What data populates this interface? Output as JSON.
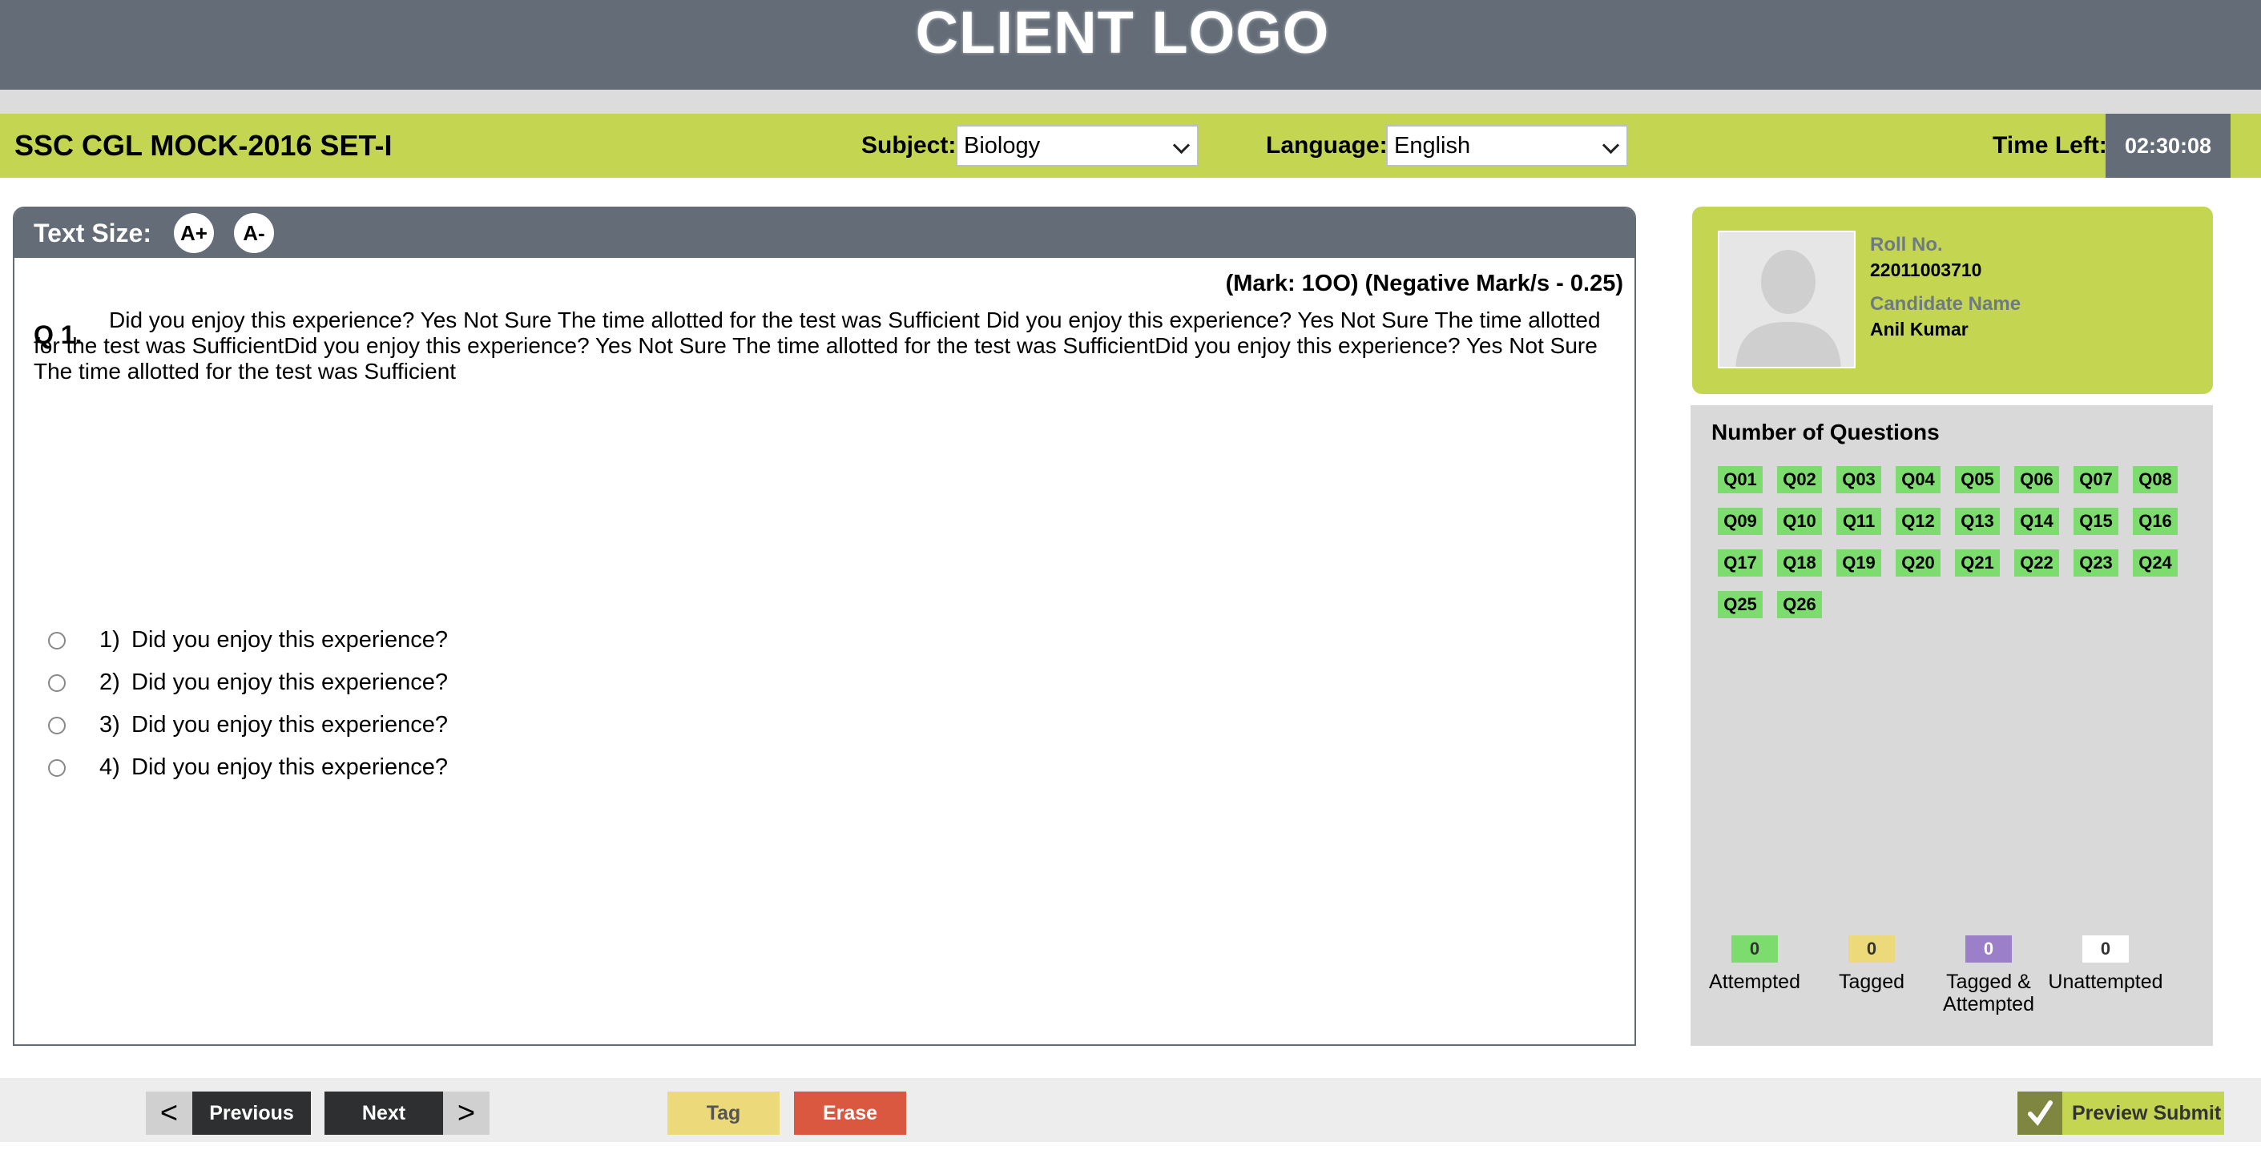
{
  "header": {
    "logo_text": "CLIENT LOGO"
  },
  "exam": {
    "title": "SSC CGL MOCK-2016 SET-I",
    "subject_label": "Subject:",
    "subject_value": "Biology",
    "language_label": "Language:",
    "language_value": "English",
    "time_left_label": "Time Left:",
    "time_left_value": "02:30:08"
  },
  "question_panel": {
    "text_size_label": "Text Size:",
    "increase_label": "A+",
    "decrease_label": "A-",
    "marks": "(Mark: 1OO) (Negative Mark/s - 0.25)",
    "question_number": "Q 1.",
    "question_text": "Did you enjoy this experience? Yes Not Sure The time allotted for the test was Sufficient Did you enjoy this experience? Yes Not Sure The time allotted for the test was SufficientDid you enjoy this experience? Yes Not Sure The time allotted for the test was SufficientDid you enjoy this experience? Yes Not Sure The time allotted for the test was Sufficient",
    "options": [
      {
        "num": "1)",
        "text": "Did you enjoy this experience?"
      },
      {
        "num": "2)",
        "text": "Did you enjoy this experience?"
      },
      {
        "num": "3)",
        "text": "Did you enjoy this experience?"
      },
      {
        "num": "4)",
        "text": "Did you enjoy this experience?"
      }
    ]
  },
  "candidate": {
    "roll_label": "Roll No.",
    "roll_value": "22011003710",
    "name_label": "Candidate Name",
    "name_value": "Anil Kumar"
  },
  "palette": {
    "title": "Number of Questions",
    "questions": [
      "Q01",
      "Q02",
      "Q03",
      "Q04",
      "Q05",
      "Q06",
      "Q07",
      "Q08",
      "Q09",
      "Q10",
      "Q11",
      "Q12",
      "Q13",
      "Q14",
      "Q15",
      "Q16",
      "Q17",
      "Q18",
      "Q19",
      "Q20",
      "Q21",
      "Q22",
      "Q23",
      "Q24",
      "Q25",
      "Q26"
    ],
    "legend": [
      {
        "count": "0",
        "label_line1": "Attempted",
        "label_line2": "",
        "color": "#7ddc6e"
      },
      {
        "count": "0",
        "label_line1": "Tagged",
        "label_line2": "",
        "color": "#ecd97a"
      },
      {
        "count": "0",
        "label_line1": "Tagged &",
        "label_line2": "Attempted",
        "color": "#9b7fc8"
      },
      {
        "count": "0",
        "label_line1": "Unattempted",
        "label_line2": "",
        "color": "#ffffff"
      }
    ]
  },
  "footer": {
    "prev_arrow": "<",
    "previous_label": "Previous",
    "next_label": "Next",
    "next_arrow": ">",
    "tag_label": "Tag",
    "erase_label": "Erase",
    "preview_submit_label": "Preview Submit"
  },
  "colors": {
    "header_bg": "#636c77",
    "accent_green": "#c4d651",
    "tag_yellow": "#ecd97a",
    "erase_red": "#d9583f",
    "submit_olive": "#7e8640"
  }
}
